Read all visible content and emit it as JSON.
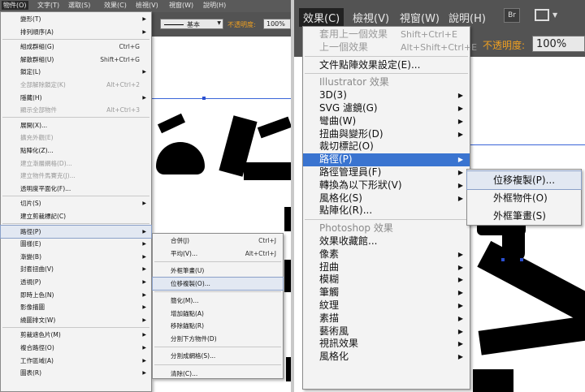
{
  "left": {
    "menubar": [
      "物件(O)",
      "文字(T)",
      "選取(S)",
      "效果(C)",
      "檢視(V)",
      "視窗(W)",
      "說明(H)"
    ],
    "stroke_label": "基本",
    "opacity_label": "不透明度:",
    "opacity_value": "100%",
    "menu": [
      {
        "label": "變形(T)",
        "sub": true
      },
      {
        "label": "排列順序(A)",
        "sub": true
      },
      {
        "label": "組成群組(G)",
        "key": "Ctrl+G"
      },
      {
        "label": "解散群組(U)",
        "key": "Shift+Ctrl+G"
      },
      {
        "label": "鎖定(L)",
        "sub": true
      },
      {
        "label": "全部解除鎖定(K)",
        "key": "Alt+Ctrl+2",
        "dis": true
      },
      {
        "label": "隱藏(H)",
        "sub": true
      },
      {
        "label": "顯示全部物件",
        "key": "Alt+Ctrl+3",
        "dis": true
      },
      {
        "label": "展開(X)..."
      },
      {
        "label": "擴充外觀(E)",
        "dis": true
      },
      {
        "label": "點陣化(Z)..."
      },
      {
        "label": "建立漸層網格(D)...",
        "dis": true
      },
      {
        "label": "建立物件馬賽克(J)...",
        "dis": true
      },
      {
        "label": "透明度平面化(F)..."
      },
      {
        "label": "切片(S)",
        "sub": true
      },
      {
        "label": "建立剪裁標記(C)"
      },
      {
        "label": "路徑(P)",
        "sub": true,
        "hl": true
      },
      {
        "label": "圖樣(E)",
        "sub": true
      },
      {
        "label": "漸變(B)",
        "sub": true
      },
      {
        "label": "封套扭曲(V)",
        "sub": true
      },
      {
        "label": "透視(P)",
        "sub": true
      },
      {
        "label": "即時上色(N)",
        "sub": true
      },
      {
        "label": "影像描圖",
        "sub": true
      },
      {
        "label": "繞圖排文(W)",
        "sub": true
      },
      {
        "label": "剪裁遮色片(M)",
        "sub": true
      },
      {
        "label": "複合路徑(O)",
        "sub": true
      },
      {
        "label": "工作區域(A)",
        "sub": true
      },
      {
        "label": "圖表(R)",
        "sub": true
      }
    ],
    "submenu": [
      {
        "label": "合併(J)",
        "key": "Ctrl+J"
      },
      {
        "label": "平均(V)...",
        "key": "Alt+Ctrl+J"
      },
      {
        "label": "外框筆畫(U)"
      },
      {
        "label": "位移複製(O)...",
        "hl": true
      },
      {
        "label": "簡化(M)..."
      },
      {
        "label": "增加錨點(A)"
      },
      {
        "label": "移除錨點(R)"
      },
      {
        "label": "分割下方物件(D)"
      },
      {
        "label": "分割成網格(S)..."
      },
      {
        "label": "清除(C)..."
      }
    ]
  },
  "right": {
    "menubar": [
      "效果(C)",
      "檢視(V)",
      "視窗(W)",
      "說明(H)"
    ],
    "br_label": "Br",
    "opacity_label": "不透明度:",
    "opacity_value": "100%",
    "menu": [
      {
        "label": "套用上一個效果",
        "key": "Shift+Ctrl+E",
        "dis": true
      },
      {
        "label": "上一個效果",
        "key": "Alt+Shift+Ctrl+E",
        "dis": true
      },
      {
        "label": "文件點陣效果設定(E)..."
      },
      {
        "label": "Illustrator 效果",
        "sec": true
      },
      {
        "label": "3D(3)",
        "sub": true
      },
      {
        "label": "SVG 濾鏡(G)",
        "sub": true
      },
      {
        "label": "彎曲(W)",
        "sub": true
      },
      {
        "label": "扭曲與變形(D)",
        "sub": true
      },
      {
        "label": "裁切標記(O)"
      },
      {
        "label": "路徑(P)",
        "sub": true,
        "hl": true
      },
      {
        "label": "路徑管理員(F)",
        "sub": true
      },
      {
        "label": "轉換為以下形狀(V)",
        "sub": true
      },
      {
        "label": "風格化(S)",
        "sub": true
      },
      {
        "label": "點陣化(R)..."
      },
      {
        "label": "Photoshop 效果",
        "sec": true
      },
      {
        "label": "效果收藏館..."
      },
      {
        "label": "像素",
        "sub": true
      },
      {
        "label": "扭曲",
        "sub": true
      },
      {
        "label": "模糊",
        "sub": true
      },
      {
        "label": "筆觸",
        "sub": true
      },
      {
        "label": "紋理",
        "sub": true
      },
      {
        "label": "素描",
        "sub": true
      },
      {
        "label": "藝術風",
        "sub": true
      },
      {
        "label": "視訊效果",
        "sub": true
      },
      {
        "label": "風格化",
        "sub": true
      }
    ],
    "submenu": [
      {
        "label": "位移複製(P)...",
        "hl": true
      },
      {
        "label": "外框物件(O)"
      },
      {
        "label": "外框筆畫(S)"
      }
    ]
  }
}
